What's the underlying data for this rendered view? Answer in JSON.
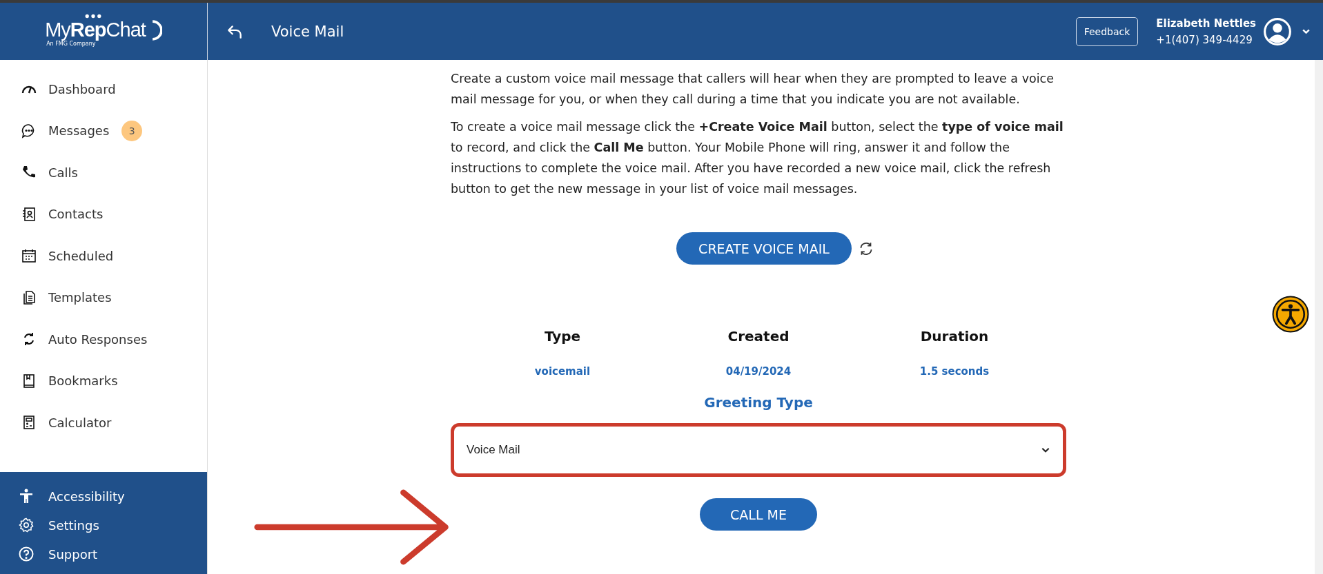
{
  "header": {
    "logo": {
      "name": "My**Rep**Chat",
      "tagline": "An FMG Company"
    },
    "title": "Voice Mail",
    "feedback": "Feedback",
    "user": {
      "name": "Elizabeth Nettles",
      "phone": "+1(407) 349-4429"
    }
  },
  "sidebar": {
    "items": [
      {
        "label": "Dashboard"
      },
      {
        "label": "Messages",
        "badge": "3"
      },
      {
        "label": "Calls"
      },
      {
        "label": "Contacts"
      },
      {
        "label": "Scheduled"
      },
      {
        "label": "Templates"
      },
      {
        "label": "Auto Responses"
      },
      {
        "label": "Bookmarks"
      },
      {
        "label": "Calculator"
      }
    ],
    "footer_items": [
      {
        "label": "Accessibility"
      },
      {
        "label": "Settings"
      },
      {
        "label": "Support"
      }
    ]
  },
  "intro": [
    "Create a custom voice mail message that callers will hear when they are prompted to leave a voice mail message for you, or when they call during a time that you indicate you are not available.",
    "To create a voice mail message click the **+Create Voice Mail** button, select the **type of voice mail** to record, and click the **Call Me** button. Your Mobile Phone will ring, answer it and follow the instructions to complete the voice mail. After you have recorded a new voice mail, click the refresh button to get the new message in your list of voice mail messages."
  ],
  "create_button": "CREATE VOICE MAIL",
  "table": {
    "columns": [
      "Type",
      "Created",
      "Duration"
    ],
    "rows": [
      [
        "voicemail",
        "04/19/2024",
        "1.5 seconds"
      ]
    ]
  },
  "greeting": {
    "label": "Greeting Type",
    "value": "Voice Mail"
  },
  "call_button": "CALL ME"
}
